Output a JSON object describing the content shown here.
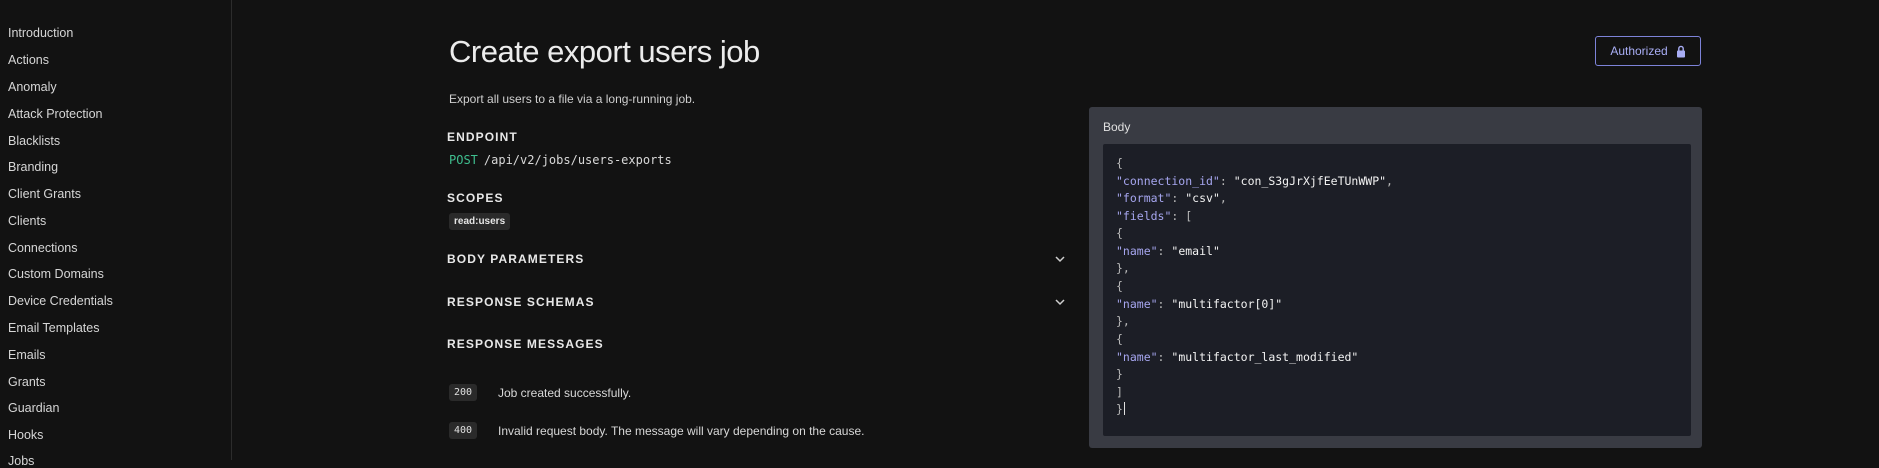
{
  "sidebar": {
    "items": [
      {
        "label": "Introduction"
      },
      {
        "label": "Actions"
      },
      {
        "label": "Anomaly"
      },
      {
        "label": "Attack Protection"
      },
      {
        "label": "Blacklists"
      },
      {
        "label": "Branding"
      },
      {
        "label": "Client Grants"
      },
      {
        "label": "Clients"
      },
      {
        "label": "Connections"
      },
      {
        "label": "Custom Domains"
      },
      {
        "label": "Device Credentials"
      },
      {
        "label": "Email Templates"
      },
      {
        "label": "Emails"
      },
      {
        "label": "Grants"
      },
      {
        "label": "Guardian"
      },
      {
        "label": "Hooks"
      },
      {
        "label": "Jobs"
      }
    ]
  },
  "page": {
    "title": "Create export users job",
    "description": "Export all users to a file via a long-running job.",
    "authorized_label": "Authorized"
  },
  "endpoint": {
    "heading": "ENDPOINT",
    "method": "POST",
    "path": "/api/v2/jobs/users-exports"
  },
  "scopes": {
    "heading": "SCOPES",
    "items": [
      "read:users"
    ]
  },
  "sections": {
    "body_parameters": "BODY PARAMETERS",
    "response_schemas": "RESPONSE SCHEMAS",
    "response_messages": "RESPONSE MESSAGES"
  },
  "responses": [
    {
      "code": "200",
      "message": "Job created successfully."
    },
    {
      "code": "400",
      "message": "Invalid request body. The message will vary depending on the cause."
    }
  ],
  "body_panel": {
    "label": "Body",
    "code": {
      "open": "{",
      "connection_key": "\"connection_id\"",
      "connection_val": "\"con_S3gJrXjfEeTUnWWP\"",
      "format_key": "\"format\"",
      "format_val": "\"csv\"",
      "fields_key": "\"fields\"",
      "fields_open": "[",
      "obj_open": "{",
      "obj_close": "},",
      "obj_close_last": "}",
      "name_key": "\"name\"",
      "name_1": "\"email\"",
      "name_2": "\"multifactor[0]\"",
      "name_3": "\"multifactor_last_modified\"",
      "fields_close": "]",
      "close": "}"
    }
  },
  "icons": {
    "lock": "lock-icon",
    "chevron": "chevron-down-icon"
  },
  "colors": {
    "accent": "#7d83d9",
    "method_post": "#3fbf8f",
    "json_key": "#a6a6ef"
  }
}
